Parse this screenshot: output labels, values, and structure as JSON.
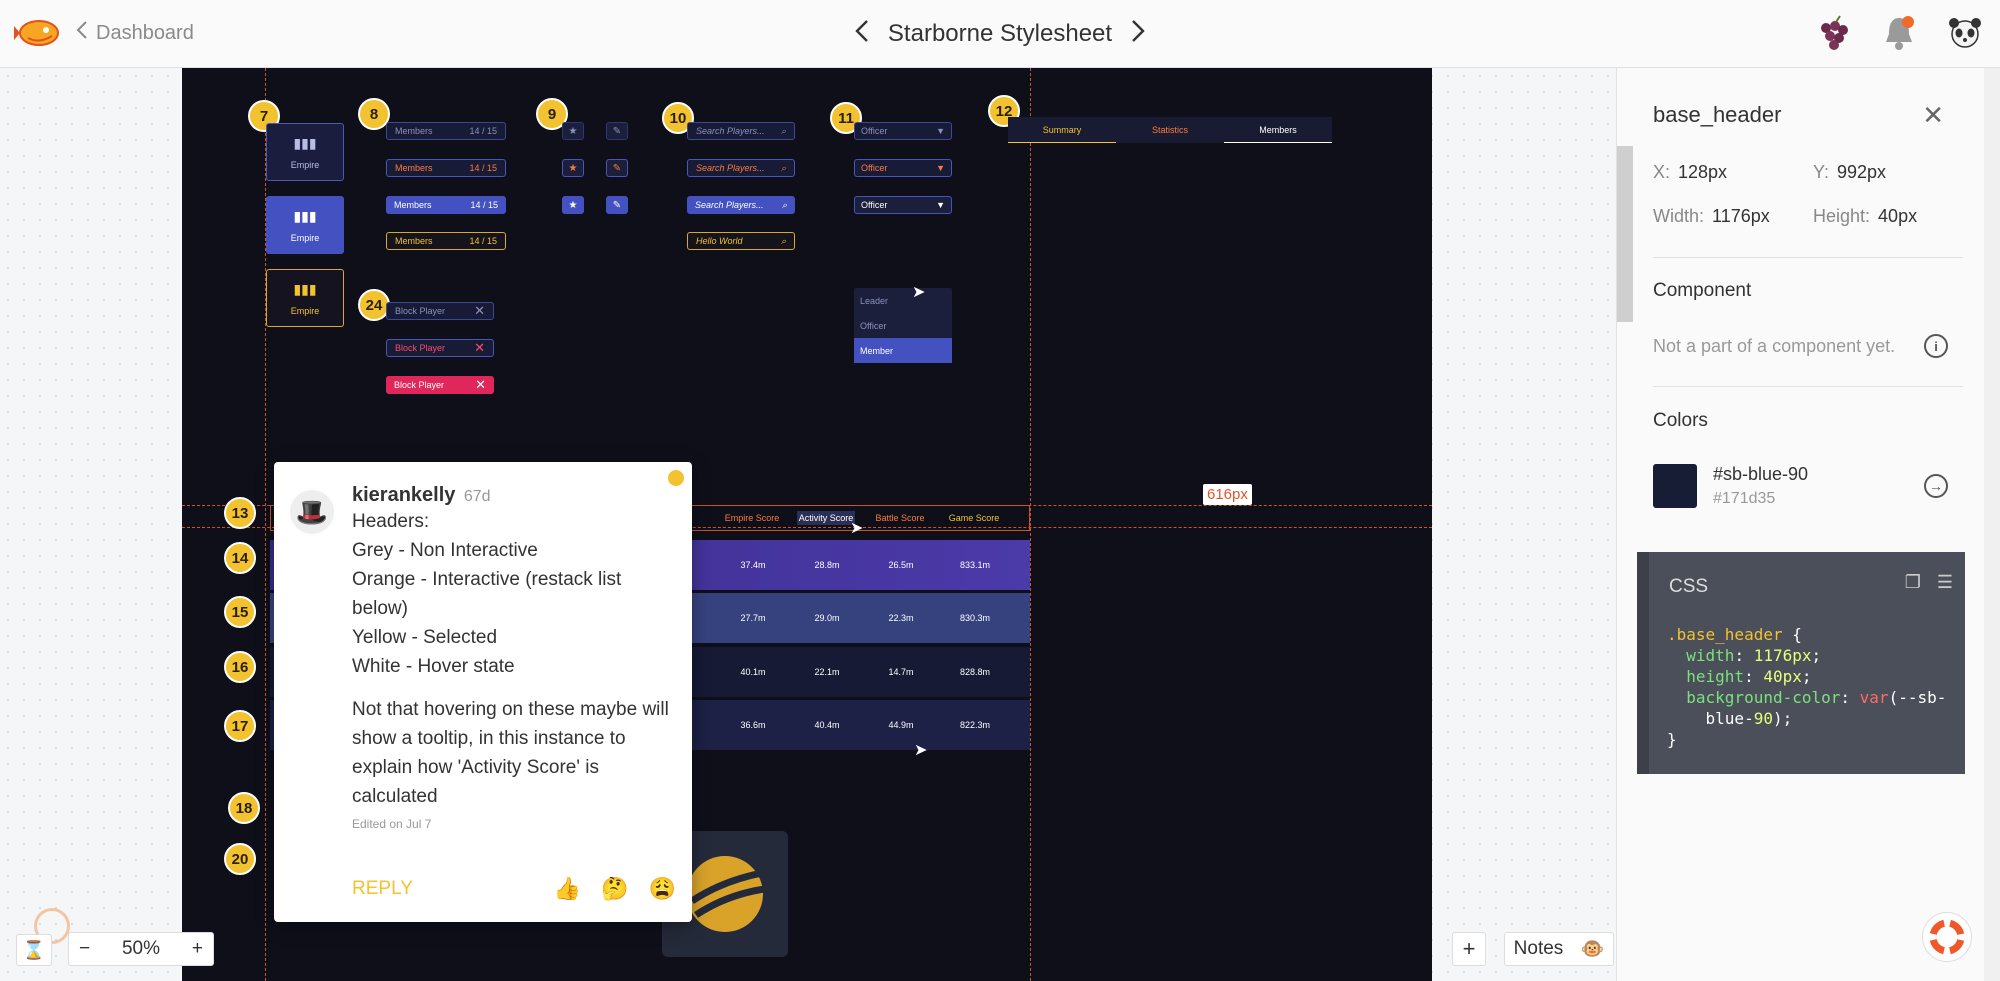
{
  "topbar": {
    "back_label": "Dashboard",
    "title": "Starborne Stylesheet"
  },
  "artboard": {
    "markers": [
      "7",
      "8",
      "9",
      "10",
      "11",
      "12",
      "24",
      "13",
      "14",
      "15",
      "16",
      "17",
      "18",
      "20"
    ],
    "tile_label": "Empire",
    "members_label": "Members",
    "members_count": "14 / 15",
    "search_placeholder": "Search Players...",
    "search_value": "Hello World",
    "dropdown_value": "Officer",
    "dropdown_options": [
      "Leader",
      "Officer",
      "Member"
    ],
    "tabs": [
      "Summary",
      "Statistics",
      "Members"
    ],
    "block_label": "Block Player",
    "score_headers": [
      "Empire Score",
      "Activity Score",
      "Battle Score",
      "Game Score"
    ],
    "score_rows": [
      [
        "37.4m",
        "28.8m",
        "26.5m",
        "833.1m"
      ],
      [
        "27.7m",
        "29.0m",
        "22.3m",
        "830.3m"
      ],
      [
        "40.1m",
        "22.1m",
        "14.7m",
        "828.8m"
      ],
      [
        "36.6m",
        "40.4m",
        "44.9m",
        "822.3m"
      ]
    ],
    "distance_label": "616px"
  },
  "comment": {
    "user": "kierankelly",
    "ago": "67d",
    "lines": [
      "Headers:",
      "Grey - Non Interactive",
      "Orange - Interactive (restack list below)",
      "Yellow - Selected",
      "White - Hover state"
    ],
    "paragraph": "Not that hovering on these maybe will show a tooltip, in this instance to explain how 'Activity Score' is calculated",
    "edited": "Edited on Jul 7",
    "reply_label": "REPLY",
    "reactions": [
      "👍",
      "🤔",
      "😩"
    ]
  },
  "inspector": {
    "layer_name": "base_header",
    "x_label": "X:",
    "x_value": "128px",
    "y_label": "Y:",
    "y_value": "992px",
    "width_label": "Width:",
    "width_value": "1176px",
    "height_label": "Height:",
    "height_value": "40px",
    "component_heading": "Component",
    "component_text": "Not a part of a component yet.",
    "colors_heading": "Colors",
    "color_name": "#sb-blue-90",
    "color_hex": "#171d35",
    "css_heading": "CSS"
  },
  "bottom": {
    "zoom_value": "50%",
    "notes_label": "Notes",
    "notes_emoji": "🐵"
  },
  "colors": {
    "artboard_bg": "#0f0f1a",
    "accent_yellow": "#f2c230",
    "accent_orange": "#ff7a3a",
    "accent_blue": "#4352c0",
    "swatch": "#171d35"
  }
}
